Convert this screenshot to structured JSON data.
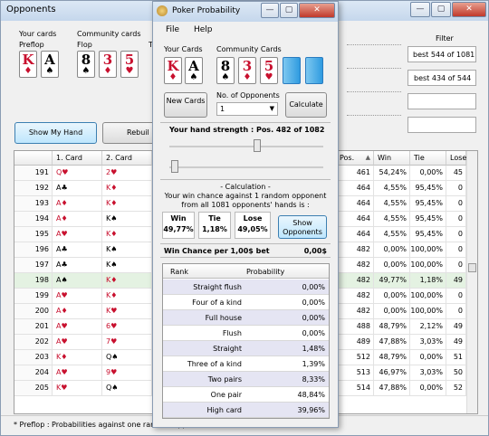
{
  "main_window": {
    "title": "Opponents",
    "your_cards_label": "Your cards",
    "preflop_label": "Preflop",
    "community_cards_label": "Community cards",
    "flop_label": "Flop",
    "turn_label": "T",
    "your_cards": [
      {
        "rank": "K",
        "suit": "♦",
        "color": "red"
      },
      {
        "rank": "A",
        "suit": "♠",
        "color": "black"
      }
    ],
    "flop_cards": [
      {
        "rank": "8",
        "suit": "♠",
        "color": "black"
      },
      {
        "rank": "3",
        "suit": "♦",
        "color": "red"
      },
      {
        "rank": "5",
        "suit": "♥",
        "color": "red"
      }
    ],
    "filter_label": "Filter",
    "filter_values": [
      "best 544 of 1081",
      "best 434 of 544"
    ],
    "show_hand_button": "Show My Hand",
    "rebuild_button": "Rebuil",
    "columns_left": [
      "1. Card",
      "2. Card"
    ],
    "columns_right": [
      "Pos.",
      "Win",
      "Tie",
      "Lose"
    ],
    "sort_icon": "▲",
    "rows": [
      {
        "n": "191",
        "c1": "Q♥",
        "c2": "2♥",
        "c1c": "red",
        "c2c": "red",
        "pos": "461",
        "win": "54,24%",
        "tie": "0,00%",
        "lose": "45"
      },
      {
        "n": "192",
        "c1": "A♣",
        "c2": "K♦",
        "c1c": "black",
        "c2c": "red",
        "pos": "464",
        "win": "4,55%",
        "tie": "95,45%",
        "lose": "0"
      },
      {
        "n": "193",
        "c1": "A♦",
        "c2": "K♦",
        "c1c": "red",
        "c2c": "red",
        "pos": "464",
        "win": "4,55%",
        "tie": "95,45%",
        "lose": "0"
      },
      {
        "n": "194",
        "c1": "A♦",
        "c2": "K♠",
        "c1c": "red",
        "c2c": "black",
        "pos": "464",
        "win": "4,55%",
        "tie": "95,45%",
        "lose": "0"
      },
      {
        "n": "195",
        "c1": "A♥",
        "c2": "K♦",
        "c1c": "red",
        "c2c": "red",
        "pos": "464",
        "win": "4,55%",
        "tie": "95,45%",
        "lose": "0"
      },
      {
        "n": "196",
        "c1": "A♣",
        "c2": "K♠",
        "c1c": "black",
        "c2c": "black",
        "pos": "482",
        "win": "0,00%",
        "tie": "100,00%",
        "lose": "0"
      },
      {
        "n": "197",
        "c1": "A♣",
        "c2": "K♠",
        "c1c": "black",
        "c2c": "black",
        "pos": "482",
        "win": "0,00%",
        "tie": "100,00%",
        "lose": "0"
      },
      {
        "n": "198",
        "c1": "A♠",
        "c2": "K♦",
        "c1c": "black",
        "c2c": "red",
        "pos": "482",
        "win": "49,77%",
        "tie": "1,18%",
        "lose": "49"
      },
      {
        "n": "199",
        "c1": "A♥",
        "c2": "K♦",
        "c1c": "red",
        "c2c": "red",
        "pos": "482",
        "win": "0,00%",
        "tie": "100,00%",
        "lose": "0"
      },
      {
        "n": "200",
        "c1": "A♦",
        "c2": "K♥",
        "c1c": "red",
        "c2c": "red",
        "pos": "482",
        "win": "0,00%",
        "tie": "100,00%",
        "lose": "0"
      },
      {
        "n": "201",
        "c1": "A♥",
        "c2": "6♥",
        "c1c": "red",
        "c2c": "red",
        "pos": "488",
        "win": "48,79%",
        "tie": "2,12%",
        "lose": "49"
      },
      {
        "n": "202",
        "c1": "A♥",
        "c2": "7♥",
        "c1c": "red",
        "c2c": "red",
        "pos": "489",
        "win": "47,88%",
        "tie": "3,03%",
        "lose": "49"
      },
      {
        "n": "203",
        "c1": "K♦",
        "c2": "Q♠",
        "c1c": "red",
        "c2c": "black",
        "pos": "512",
        "win": "48,79%",
        "tie": "0,00%",
        "lose": "51"
      },
      {
        "n": "204",
        "c1": "A♥",
        "c2": "9♥",
        "c1c": "red",
        "c2c": "red",
        "pos": "513",
        "win": "46,97%",
        "tie": "3,03%",
        "lose": "50"
      },
      {
        "n": "205",
        "c1": "K♥",
        "c2": "Q♠",
        "c1c": "red",
        "c2c": "black",
        "pos": "514",
        "win": "47,88%",
        "tie": "0,00%",
        "lose": "52"
      }
    ],
    "status_text": "* Preflop : Probabilities against one random opponent, ... hand."
  },
  "dialog": {
    "title": "Poker Probability",
    "menu": [
      "File",
      "Help"
    ],
    "your_cards_label": "Your Cards",
    "community_cards_label": "Community Cards",
    "your_cards": [
      {
        "rank": "K",
        "suit": "♦",
        "color": "red"
      },
      {
        "rank": "A",
        "suit": "♠",
        "color": "black"
      }
    ],
    "community_cards": [
      {
        "rank": "8",
        "suit": "♠",
        "color": "black"
      },
      {
        "rank": "3",
        "suit": "♦",
        "color": "red"
      },
      {
        "rank": "5",
        "suit": "♥",
        "color": "red"
      }
    ],
    "new_cards_button": "New Cards",
    "opponents_label": "No. of Opponents",
    "opponents_value": "1",
    "calculate_button": "Calculate",
    "hand_strength": "Your hand strength : Pos. 482 of 1082",
    "calc_header": "- Calculation -",
    "calc_text_1": "Your win chance against 1 random opponent",
    "calc_text_2": "from all 1081 opponents' hands is :",
    "win_label": "Win",
    "win_value": "49,77%",
    "tie_label": "Tie",
    "tie_value": "1,18%",
    "lose_label": "Lose",
    "lose_value": "49,05%",
    "show_opponents_button": "Show Opponents",
    "win_chance_label": "Win Chance per 1,00$ bet",
    "win_chance_value": "0,00$",
    "table_headers": [
      "Rank",
      "Probability"
    ],
    "table_rows": [
      {
        "rank": "Straight flush",
        "prob": "0,00%"
      },
      {
        "rank": "Four of a kind",
        "prob": "0,00%"
      },
      {
        "rank": "Full house",
        "prob": "0,00%"
      },
      {
        "rank": "Flush",
        "prob": "0,00%"
      },
      {
        "rank": "Straight",
        "prob": "1,48%"
      },
      {
        "rank": "Three of a kind",
        "prob": "1,39%"
      },
      {
        "rank": "Two pairs",
        "prob": "8,33%"
      },
      {
        "rank": "One pair",
        "prob": "48,84%"
      },
      {
        "rank": "High card",
        "prob": "39,96%"
      }
    ]
  }
}
